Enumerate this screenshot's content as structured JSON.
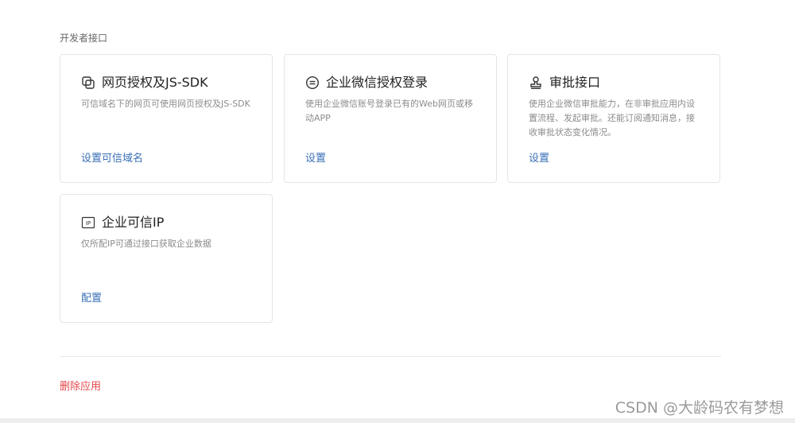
{
  "section": {
    "title": "开发者接口"
  },
  "cards": [
    {
      "title": "网页授权及JS-SDK",
      "description": "可信域名下的网页可使用网页授权及JS-SDK",
      "link": "设置可信域名",
      "icon": "copy-squares-icon"
    },
    {
      "title": "企业微信授权登录",
      "description": "使用企业微信账号登录已有的Web网页或移动APP",
      "link": "设置",
      "icon": "login-circle-icon"
    },
    {
      "title": "审批接口",
      "description": "使用企业微信审批能力，在非审批应用内设置流程、发起审批。还能订阅通知消息，接收审批状态变化情况。",
      "link": "设置",
      "icon": "approval-stamp-icon"
    },
    {
      "title": "企业可信IP",
      "description": "仅所配IP可通过接口获取企业数据",
      "link": "配置",
      "icon": "ip-badge-icon"
    }
  ],
  "footer": {
    "delete_label": "删除应用"
  },
  "watermark": "CSDN @大龄码农有梦想",
  "colors": {
    "link": "#3a6fb5",
    "danger": "#e5484d",
    "border": "#e3e5e8"
  }
}
